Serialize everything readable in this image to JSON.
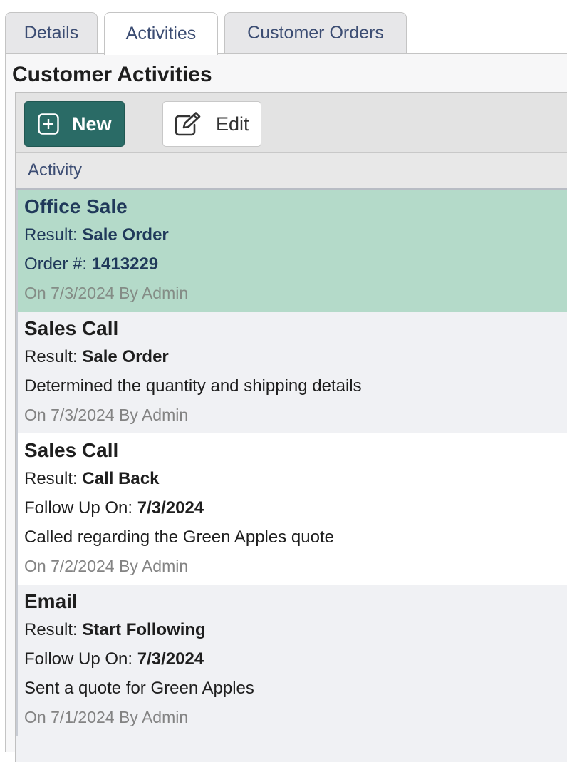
{
  "tabs": [
    {
      "label": "Details"
    },
    {
      "label": "Activities"
    },
    {
      "label": "Customer Orders"
    }
  ],
  "active_tab": "Activities",
  "panel": {
    "title": "Customer Activities"
  },
  "toolbar": {
    "new_label": "New",
    "new_icon": "plus-square-icon",
    "edit_label": "Edit",
    "edit_icon": "edit-icon"
  },
  "grid": {
    "column_header": "Activity"
  },
  "activities": [
    {
      "title": "Office Sale",
      "result_label": "Result: ",
      "result": "Sale Order",
      "extra_label": "Order #: ",
      "extra_value": "1413229",
      "meta": "On 7/3/2024 By Admin",
      "selected": true
    },
    {
      "title": "Sales Call",
      "result_label": "Result: ",
      "result": "Sale Order",
      "note": "Determined the quantity and shipping details",
      "meta": "On 7/3/2024 By Admin"
    },
    {
      "title": "Sales Call",
      "result_label": "Result: ",
      "result": "Call Back",
      "extra_label": "Follow Up On: ",
      "extra_value": "7/3/2024",
      "note": "Called regarding the Green Apples quote",
      "meta": "On 7/2/2024 By Admin"
    },
    {
      "title": "Email",
      "result_label": "Result: ",
      "result": "Start Following",
      "extra_label": "Follow Up On: ",
      "extra_value": "7/3/2024",
      "note": "Sent a quote for Green Apples",
      "meta": "On 7/1/2024 By Admin"
    }
  ],
  "colors": {
    "primary": "#2a6b66",
    "selected_row": "#b4dac9",
    "tab_text": "#3c4d73"
  }
}
